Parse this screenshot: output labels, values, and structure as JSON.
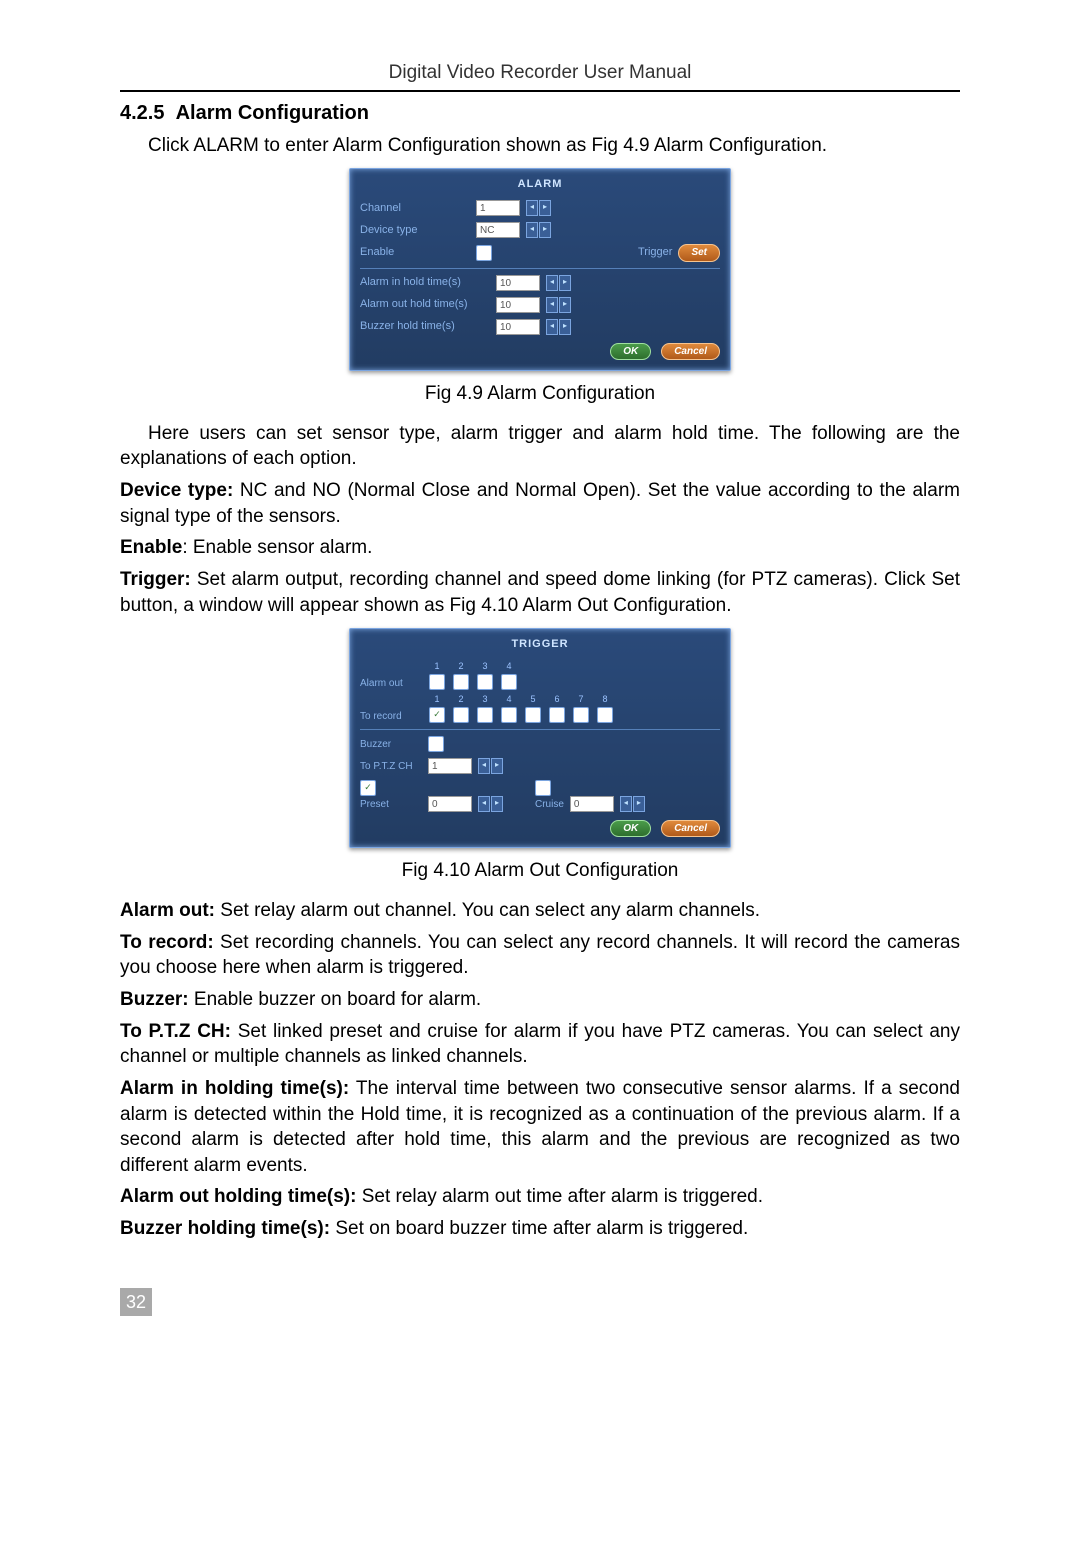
{
  "header": "Digital Video Recorder User Manual",
  "section_number": "4.2.5",
  "section_title": "Alarm Configuration",
  "intro": "Click ALARM to enter Alarm Configuration shown as Fig 4.9 Alarm Configuration.",
  "fig1_caption": "Fig 4.9 Alarm Configuration",
  "dialog1": {
    "title": "ALARM",
    "channel_label": "Channel",
    "channel_value": "1",
    "device_type_label": "Device type",
    "device_type_value": "NC",
    "enable_label": "Enable",
    "trigger_label": "Trigger",
    "set_btn": "Set",
    "alarm_in_label": "Alarm in hold time(s)",
    "alarm_in_value": "10",
    "alarm_out_label": "Alarm out hold time(s)",
    "alarm_out_value": "10",
    "buzzer_label": "Buzzer hold time(s)",
    "buzzer_value": "10",
    "ok": "OK",
    "cancel": "Cancel"
  },
  "p_here": "Here users can set sensor type, alarm trigger and alarm hold time. The following are the explanations of each option.",
  "device_type_b": "Device type:",
  "device_type_t": " NC and NO (Normal Close and Normal Open). Set the value according to the alarm signal type of the sensors.",
  "enable_b": "Enable",
  "enable_t": ": Enable sensor alarm.",
  "trigger_b": "Trigger:",
  "trigger_t": " Set alarm output, recording channel and speed dome linking (for PTZ cameras). Click Set button, a window will appear shown as Fig 4.10 Alarm Out Configuration.",
  "dialog2": {
    "title": "TRIGGER",
    "alarm_out_label": "Alarm out",
    "alarm_out_cols": [
      "1",
      "2",
      "3",
      "4"
    ],
    "to_record_label": "To record",
    "to_record_cols": [
      "1",
      "2",
      "3",
      "4",
      "5",
      "6",
      "7",
      "8"
    ],
    "to_record_checked": [
      true,
      false,
      false,
      false,
      false,
      false,
      false,
      false
    ],
    "buzzer_label": "Buzzer",
    "ptz_label": "To P.T.Z CH",
    "ptz_value": "1",
    "preset_label": "Preset",
    "preset_value": "0",
    "cruise_label": "Cruise",
    "cruise_value": "0",
    "ok": "OK",
    "cancel": "Cancel"
  },
  "fig2_caption": "Fig 4.10 Alarm Out Configuration",
  "alarm_out_b": "Alarm out:",
  "alarm_out_t": " Set relay alarm out channel. You can select any alarm channels.",
  "to_record_b": "To record:",
  "to_record_t": " Set recording channels. You can select any record channels. It will record the cameras you choose here when alarm is triggered.",
  "buzzer_b": "Buzzer:",
  "buzzer_t": " Enable buzzer on board for alarm.",
  "ptz_b": "To P.T.Z CH:",
  "ptz_t": " Set linked preset and cruise for alarm if you have PTZ cameras. You can select any channel or multiple channels as linked channels.",
  "alarm_in_hold_b": "Alarm in holding time(s):",
  "alarm_in_hold_t": " The interval time between two consecutive sensor alarms. If a second alarm is detected within the Hold time, it is recognized as a continuation of the previous alarm. If a second alarm is detected after hold time, this alarm and the previous are recognized as two different alarm events.",
  "alarm_out_hold_b": "Alarm out holding time(s):",
  "alarm_out_hold_t": " Set relay alarm out time after alarm is triggered.",
  "buzzer_hold_b": "Buzzer holding time(s):",
  "buzzer_hold_t": " Set on board buzzer time after alarm is triggered.",
  "page_num": "32"
}
